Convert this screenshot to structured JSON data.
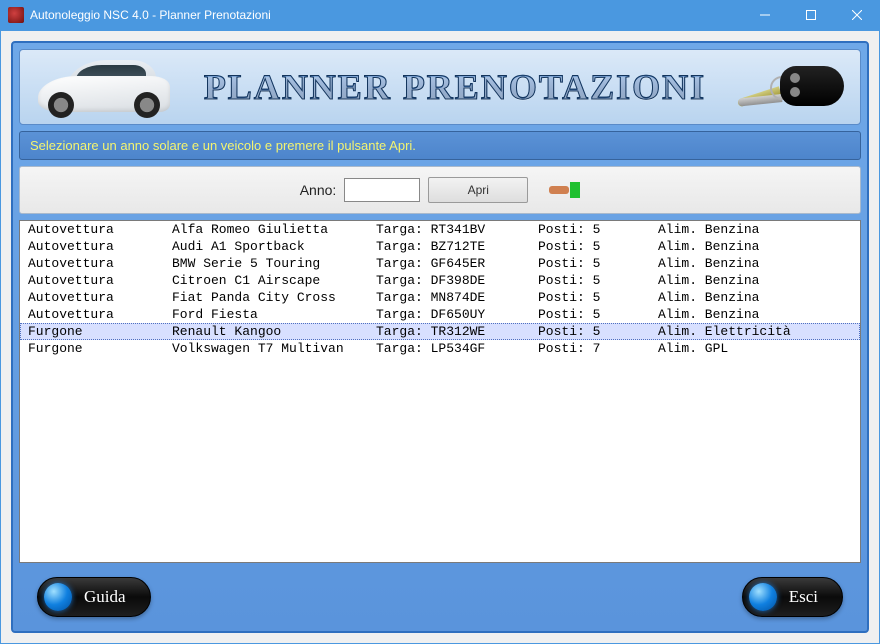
{
  "window": {
    "title": "Autonoleggio NSC 4.0 - Planner Prenotazioni"
  },
  "header": {
    "title": "PLANNER PRENOTAZIONI"
  },
  "instruction": "Selezionare un anno solare e un veicolo e premere il pulsante Apri.",
  "controls": {
    "year_label": "Anno:",
    "year_value": "",
    "open_label": "Apri"
  },
  "columns": {
    "plate_prefix": "Targa: ",
    "seats_prefix": "Posti: ",
    "fuel_prefix": "Alim. "
  },
  "vehicles": [
    {
      "type": "Autovettura",
      "model": "Alfa Romeo Giulietta",
      "plate": "RT341BV",
      "seats": "5",
      "fuel": "Benzina",
      "selected": false
    },
    {
      "type": "Autovettura",
      "model": "Audi A1 Sportback",
      "plate": "BZ712TE",
      "seats": "5",
      "fuel": "Benzina",
      "selected": false
    },
    {
      "type": "Autovettura",
      "model": "BMW Serie 5 Touring",
      "plate": "GF645ER",
      "seats": "5",
      "fuel": "Benzina",
      "selected": false
    },
    {
      "type": "Autovettura",
      "model": "Citroen C1 Airscape",
      "plate": "DF398DE",
      "seats": "5",
      "fuel": "Benzina",
      "selected": false
    },
    {
      "type": "Autovettura",
      "model": "Fiat Panda City Cross",
      "plate": "MN874DE",
      "seats": "5",
      "fuel": "Benzina",
      "selected": false
    },
    {
      "type": "Autovettura",
      "model": "Ford Fiesta",
      "plate": "DF650UY",
      "seats": "5",
      "fuel": "Benzina",
      "selected": false
    },
    {
      "type": "Furgone",
      "model": "Renault Kangoo",
      "plate": "TR312WE",
      "seats": "5",
      "fuel": "Elettricità",
      "selected": true
    },
    {
      "type": "Furgone",
      "model": "Volkswagen T7 Multivan",
      "plate": "LP534GF",
      "seats": "7",
      "fuel": "GPL",
      "selected": false
    }
  ],
  "footer": {
    "help_label": "Guida",
    "exit_label": "Esci"
  }
}
